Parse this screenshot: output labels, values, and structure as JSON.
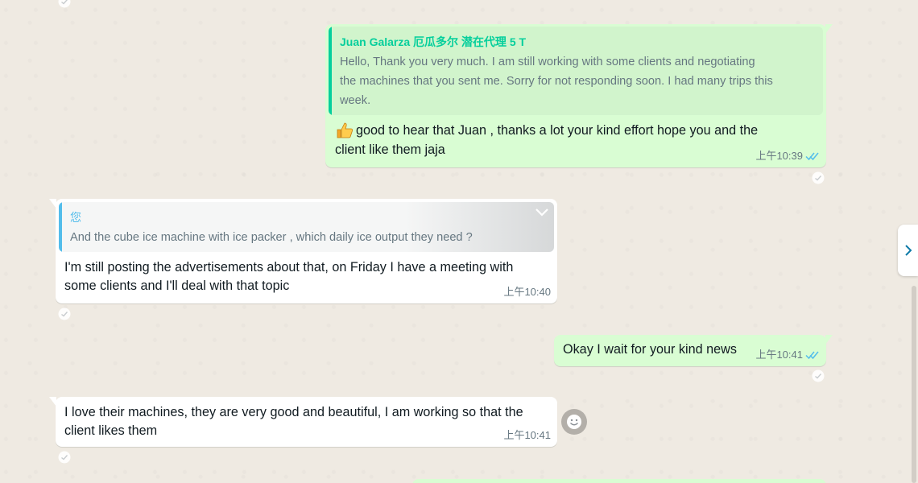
{
  "colors": {
    "wallpaper": "#efeae2",
    "outgoing_bubble": "#d9fdd3",
    "incoming_bubble": "#ffffff",
    "read_ticks": "#53bdeb",
    "quote_author_green": "#06cf9c",
    "quote_author_blue": "#53bdeb"
  },
  "messages": [
    {
      "direction": "outgoing",
      "quote": {
        "author": "Juan Galarza 厄瓜多尔 潜在代理 5 T",
        "lines": [
          "Hello, Thank you very much. I am still working with some clients and negotiating",
          "the machines that you sent me. Sorry for not responding soon. I had many trips this",
          "week."
        ]
      },
      "emoji": "thumbs-up",
      "lines": [
        "good to hear that Juan , thanks a lot your kind effort  hope you and the",
        "client like them jaja"
      ],
      "time": "上午10:39",
      "status": "read"
    },
    {
      "direction": "incoming",
      "quote": {
        "author": "您",
        "lines": [
          "And the cube ice machine with ice packer , which daily ice output they need ?"
        ]
      },
      "lines": [
        "I'm still posting the advertisements about that, on Friday I have a meeting with",
        "some clients and I'll deal with that topic"
      ],
      "time": "上午10:40"
    },
    {
      "direction": "outgoing",
      "lines": [
        "Okay I wait for your kind news"
      ],
      "time": "上午10:41",
      "status": "read"
    },
    {
      "direction": "incoming",
      "lines": [
        "I love their machines, they are very good and beautiful, I am working so that the",
        "client likes them"
      ],
      "time": "上午10:41"
    }
  ],
  "icons": {
    "reaction": "react-icon",
    "menu_chevron": "chevron-down-icon",
    "emoji": "emoji-icon",
    "side_panel": "chevron-right-icon"
  }
}
